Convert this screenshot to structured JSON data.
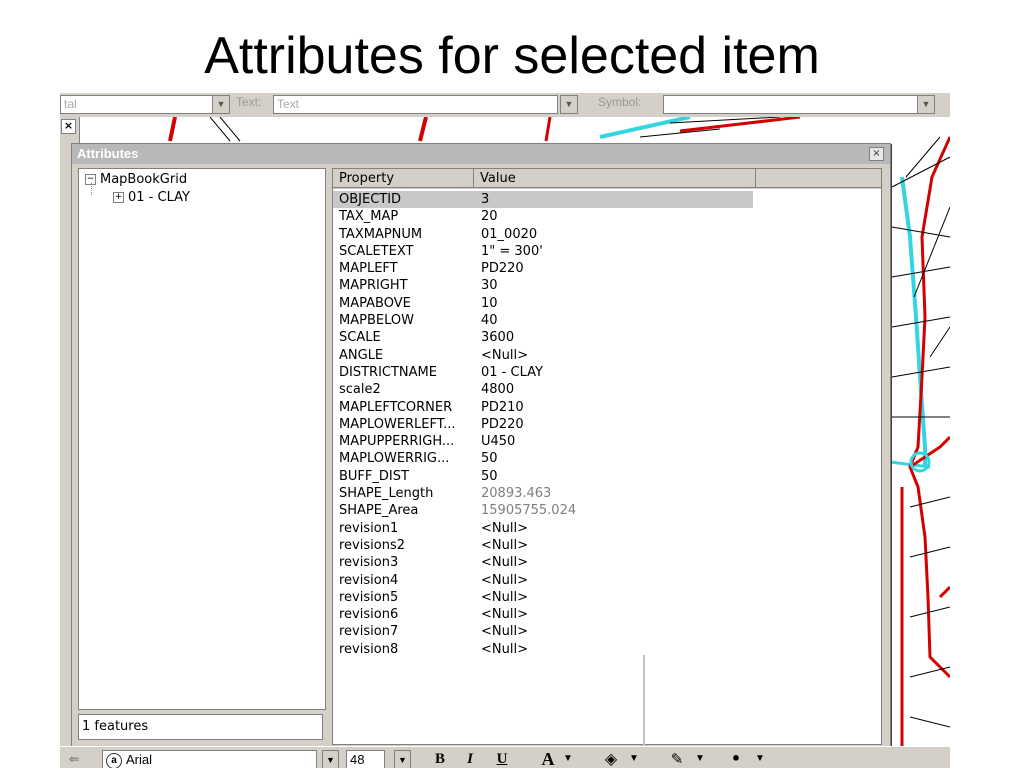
{
  "slide": {
    "title": "Attributes for selected item"
  },
  "top_toolbar": {
    "field1": "tal",
    "label_text": "Text:",
    "text_value": "Text",
    "label_symbol": "Symbol:"
  },
  "dialog": {
    "title": "Attributes",
    "close_glyph": "×",
    "tree": {
      "root": {
        "label": "MapBookGrid",
        "toggle": "−"
      },
      "child": {
        "label": "01 - CLAY",
        "toggle": "+"
      }
    },
    "status": "1 features",
    "columns": {
      "property": "Property",
      "value": "Value"
    },
    "rows": [
      {
        "property": "OBJECTID",
        "value": "3"
      },
      {
        "property": "TAX_MAP",
        "value": "20"
      },
      {
        "property": "TAXMAPNUM",
        "value": "01_0020"
      },
      {
        "property": "SCALETEXT",
        "value": "1\" = 300'"
      },
      {
        "property": "MAPLEFT",
        "value": "PD220"
      },
      {
        "property": "MAPRIGHT",
        "value": "30"
      },
      {
        "property": "MAPABOVE",
        "value": "10"
      },
      {
        "property": "MAPBELOW",
        "value": "40"
      },
      {
        "property": "SCALE",
        "value": "3600"
      },
      {
        "property": "ANGLE",
        "value": "<Null>"
      },
      {
        "property": "DISTRICTNAME",
        "value": "01 - CLAY"
      },
      {
        "property": "scale2",
        "value": "4800"
      },
      {
        "property": "MAPLEFTCORNER",
        "value": "PD210"
      },
      {
        "property": "MAPLOWERLEFT...",
        "value": "PD220"
      },
      {
        "property": "MAPUPPERRIGH...",
        "value": "U450"
      },
      {
        "property": "MAPLOWERRIG...",
        "value": "50"
      },
      {
        "property": "BUFF_DIST",
        "value": "50"
      },
      {
        "property": "SHAPE_Length",
        "value": "20893.463"
      },
      {
        "property": "SHAPE_Area",
        "value": "15905755.024"
      },
      {
        "property": "revision1",
        "value": "<Null>"
      },
      {
        "property": "revisions2",
        "value": "<Null>"
      },
      {
        "property": "revision3",
        "value": "<Null>"
      },
      {
        "property": "revision4",
        "value": "<Null>"
      },
      {
        "property": "revision5",
        "value": "<Null>"
      },
      {
        "property": "revision6",
        "value": "<Null>"
      },
      {
        "property": "revision7",
        "value": "<Null>"
      },
      {
        "property": "revision8",
        "value": "<Null>"
      }
    ]
  },
  "bottom_toolbar": {
    "font_name": "Arial",
    "font_size": "48",
    "bold": "B",
    "italic": "I",
    "underline": "U",
    "font_color": "A"
  },
  "colors": {
    "map_red": "#d40000",
    "map_cyan": "#33d6e0",
    "selected_row": "#c8c8c8",
    "chrome": "#d4d0c8"
  }
}
